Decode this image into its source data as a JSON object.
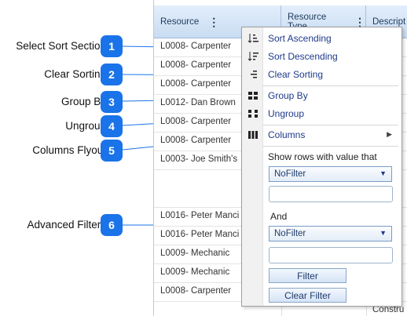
{
  "callouts": [
    {
      "n": "1",
      "label": "Select Sort Section"
    },
    {
      "n": "2",
      "label": "Clear Sorting"
    },
    {
      "n": "3",
      "label": "Group By"
    },
    {
      "n": "4",
      "label": "Ungroup"
    },
    {
      "n": "5",
      "label": "Columns Flyout"
    },
    {
      "n": "6",
      "label": "Advanced Filters"
    }
  ],
  "grid": {
    "headers": [
      "Resource",
      "Resource Type",
      "Descript"
    ],
    "kebab": "⋮",
    "rows": [
      {
        "resource": "L0008- Carpenter",
        "desc": ""
      },
      {
        "resource": "L0008- Carpenter",
        "desc": ""
      },
      {
        "resource": "L0008- Carpenter",
        "desc": ""
      },
      {
        "resource": "L0012- Dan Brown",
        "desc": ""
      },
      {
        "resource": "L0008- Carpenter",
        "desc": ""
      },
      {
        "resource": "L0008- Carpenter",
        "desc": ""
      },
      {
        "resource": "L0003- Joe Smith's",
        "desc": ""
      },
      {
        "resource": "",
        "desc": ""
      },
      {
        "resource": "L0016- Peter Manci",
        "desc": ""
      },
      {
        "resource": "L0016- Peter Manci",
        "desc": ""
      },
      {
        "resource": "L0009- Mechanic",
        "desc": ""
      },
      {
        "resource": "L0009- Mechanic",
        "desc": ""
      },
      {
        "resource": "L0008- Carpenter",
        "desc": ""
      },
      {
        "resource": "",
        "desc": ""
      },
      {
        "resource": "",
        "desc": "Constru"
      }
    ]
  },
  "menu": {
    "sort_ascending": "Sort Ascending",
    "sort_descending": "Sort Descending",
    "clear_sorting": "Clear Sorting",
    "group_by": "Group By",
    "ungroup": "Ungroup",
    "columns": "Columns",
    "show_rows_label": "Show rows with value that",
    "filter1_value": "NoFilter",
    "and_label": "And",
    "filter2_value": "NoFilter",
    "filter_button": "Filter",
    "clear_filter_button": "Clear Filter"
  },
  "colors": {
    "badge": "#1a73e8",
    "header": "#c9dcf2",
    "menu_link": "#1e3a8a"
  }
}
